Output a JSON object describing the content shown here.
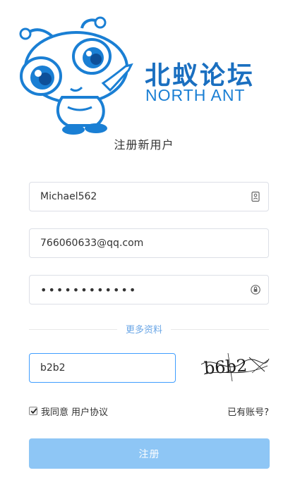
{
  "logo": {
    "name_cn": "北蚁论坛",
    "name_en": "NORTH ANT"
  },
  "title": "注册新用户",
  "form": {
    "username": {
      "value": "Michael562",
      "icon": "id-card-icon"
    },
    "email": {
      "value": "766060633@qq.com"
    },
    "password": {
      "value": "••••••••••••",
      "icon": "lock-icon"
    },
    "more_info_label": "更多资料",
    "captcha": {
      "value": "b2b2",
      "image_text": "b6b2"
    },
    "agree_checked": true,
    "agree_label": "我同意",
    "agreement_link": "用户协议",
    "have_account_link": "已有账号?",
    "submit_label": "注册"
  },
  "colors": {
    "brand_blue": "#1a6fc0",
    "accent": "#409eff",
    "button": "#8ec6f5",
    "divider_text": "#6aa6e6"
  }
}
